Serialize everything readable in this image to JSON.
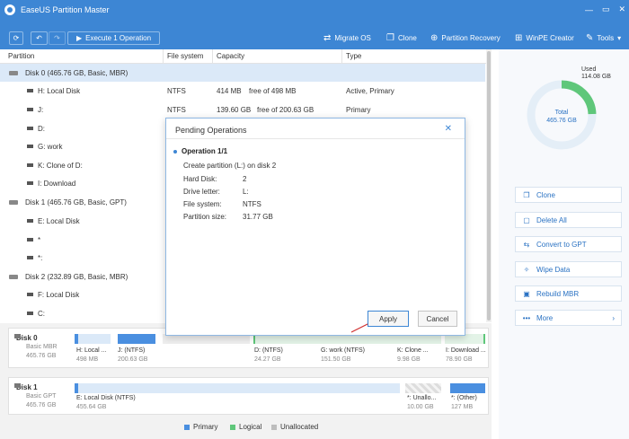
{
  "window": {
    "title": "EaseUS Partition Master",
    "minimize": "▭",
    "close": "✕"
  },
  "toolbar": {
    "execute_label": "Execute 1 Operation",
    "items": [
      {
        "icon": "migrate-os-icon",
        "label": "Migrate OS"
      },
      {
        "icon": "clone-icon",
        "label": "Clone"
      },
      {
        "icon": "partition-recovery-icon",
        "label": "Partition Recovery"
      },
      {
        "icon": "winpe-icon",
        "label": "WinPE Creator"
      },
      {
        "icon": "tools-icon",
        "label": "Tools"
      }
    ]
  },
  "table": {
    "headers": [
      "Partition",
      "File system",
      "Capacity",
      "Type"
    ],
    "rows": [
      {
        "kind": "disk",
        "name": "Disk 0 (465.76 GB, Basic, MBR)",
        "selected": true
      },
      {
        "kind": "part",
        "name": "H: Local Disk",
        "fs": "NTFS",
        "used": "414 MB",
        "free": "free of 498 MB",
        "type": "Active, Primary"
      },
      {
        "kind": "part",
        "name": "J:",
        "fs": "NTFS",
        "used": "139.60 GB",
        "free": "free of 200.63 GB",
        "type": "Primary"
      },
      {
        "kind": "part",
        "name": "D:"
      },
      {
        "kind": "part",
        "name": "G: work"
      },
      {
        "kind": "part",
        "name": "K: Clone of D:"
      },
      {
        "kind": "part",
        "name": "I: Download"
      },
      {
        "kind": "disk",
        "name": "Disk 1 (465.76 GB, Basic, GPT)"
      },
      {
        "kind": "part",
        "name": "E: Local Disk"
      },
      {
        "kind": "part",
        "name": "*"
      },
      {
        "kind": "part",
        "name": "*:"
      },
      {
        "kind": "disk",
        "name": "Disk 2 (232.89 GB, Basic, MBR)"
      },
      {
        "kind": "part",
        "name": "F: Local Disk"
      },
      {
        "kind": "part",
        "name": "C:"
      }
    ]
  },
  "diskmap": {
    "disk0": {
      "name": "Disk 0",
      "type": "Basic MBR",
      "size": "465.76 GB",
      "segments": [
        {
          "label": "H: Local ...",
          "size": "498 MB"
        },
        {
          "label": "J: (NTFS)",
          "size": "200.63 GB"
        },
        {
          "label": "D: (NTFS)",
          "size": "24.27 GB"
        },
        {
          "label": "G: work (NTFS)",
          "size": "151.50 GB"
        },
        {
          "label": "K: Clone ...",
          "size": "9.98 GB"
        },
        {
          "label": "I: Download ...",
          "size": "78.90 GB"
        }
      ]
    },
    "disk1": {
      "name": "Disk 1",
      "type": "Basic GPT",
      "size": "465.76 GB",
      "segments": [
        {
          "label": "E: Local Disk (NTFS)",
          "size": "455.64 GB"
        },
        {
          "label": "*: Unallo...",
          "size": "10.00 GB"
        },
        {
          "label": "*: (Other)",
          "size": "127 MB"
        }
      ]
    },
    "legend": [
      {
        "label": "Primary",
        "color": "#4a8fe0"
      },
      {
        "label": "Logical",
        "color": "#5fc77a"
      },
      {
        "label": "Unallocated",
        "color": "#bdbdbd"
      }
    ]
  },
  "usage": {
    "used_label": "Used",
    "used_value": "114.08 GB",
    "total_label": "Total",
    "total_value": "465.76 GB",
    "used_fraction": 0.245
  },
  "actions": [
    {
      "icon": "clone-icon",
      "label": "Clone"
    },
    {
      "icon": "delete-icon",
      "label": "Delete All"
    },
    {
      "icon": "convert-icon",
      "label": "Convert to GPT"
    },
    {
      "icon": "wipe-icon",
      "label": "Wipe Data"
    },
    {
      "icon": "rebuild-icon",
      "label": "Rebuild MBR"
    },
    {
      "icon": "more-icon",
      "label": "More"
    }
  ],
  "dialog": {
    "title": "Pending Operations",
    "operation": "Operation 1/1",
    "description": "Create partition (L:) on disk 2",
    "fields": [
      {
        "key": "Hard Disk:",
        "value": "2"
      },
      {
        "key": "Drive letter:",
        "value": "L:"
      },
      {
        "key": "File system:",
        "value": "NTFS"
      },
      {
        "key": "Partition size:",
        "value": "31.77 GB"
      }
    ],
    "apply_label": "Apply",
    "cancel_label": "Cancel"
  }
}
